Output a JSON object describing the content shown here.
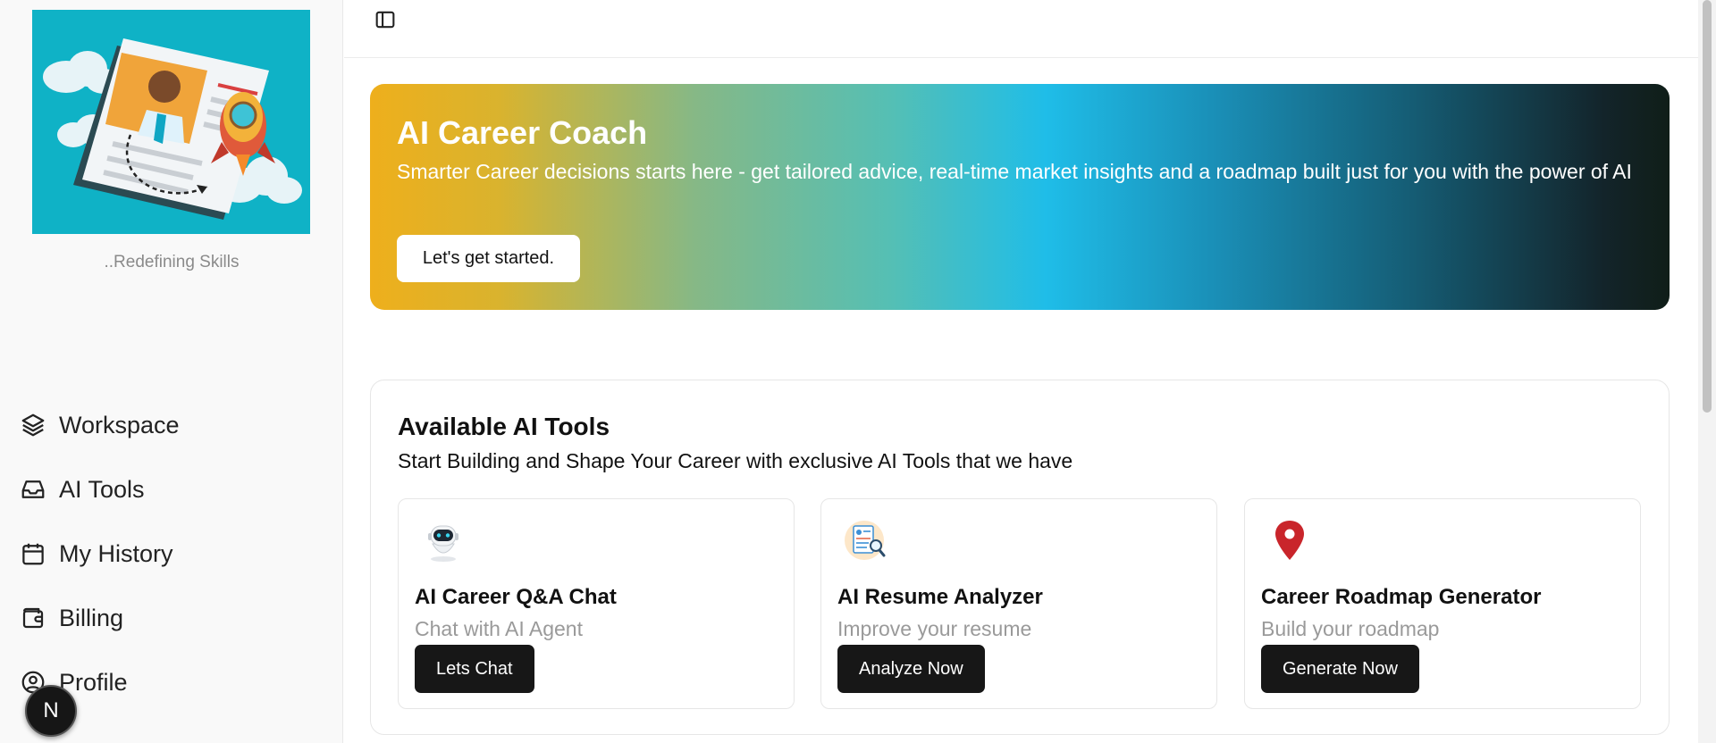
{
  "sidebar": {
    "tagline": "..Redefining Skills",
    "items": [
      {
        "label": "Workspace",
        "icon": "layers-icon"
      },
      {
        "label": "AI Tools",
        "icon": "inbox-icon"
      },
      {
        "label": "My History",
        "icon": "calendar-icon"
      },
      {
        "label": "Billing",
        "icon": "wallet-icon"
      },
      {
        "label": "Profile",
        "icon": "user-circle-icon"
      }
    ],
    "avatar_letter": "N"
  },
  "hero": {
    "title": "AI Career Coach",
    "subtitle": "Smarter Career decisions starts here - get tailored advice, real-time market insights and a roadmap built just for you with the power of AI",
    "button": "Let's get started."
  },
  "tools": {
    "title": "Available AI Tools",
    "subtitle": "Start Building and Shape Your Career with exclusive AI Tools that we have",
    "items": [
      {
        "name": "AI Career Q&A Chat",
        "desc": "Chat with AI Agent",
        "button": "Lets Chat",
        "icon": "robot-icon"
      },
      {
        "name": "AI Resume Analyzer",
        "desc": "Improve your resume",
        "button": "Analyze Now",
        "icon": "resume-search-icon"
      },
      {
        "name": "Career Roadmap Generator",
        "desc": "Build your roadmap",
        "button": "Generate Now",
        "icon": "map-pin-icon"
      }
    ]
  },
  "colors": {
    "accent_dark": "#171717",
    "logo_bg": "#0fb2c6",
    "hero_gradient_start": "#eeaf1c",
    "hero_gradient_mid": "#1fbde8",
    "hero_gradient_end": "#101e18"
  }
}
